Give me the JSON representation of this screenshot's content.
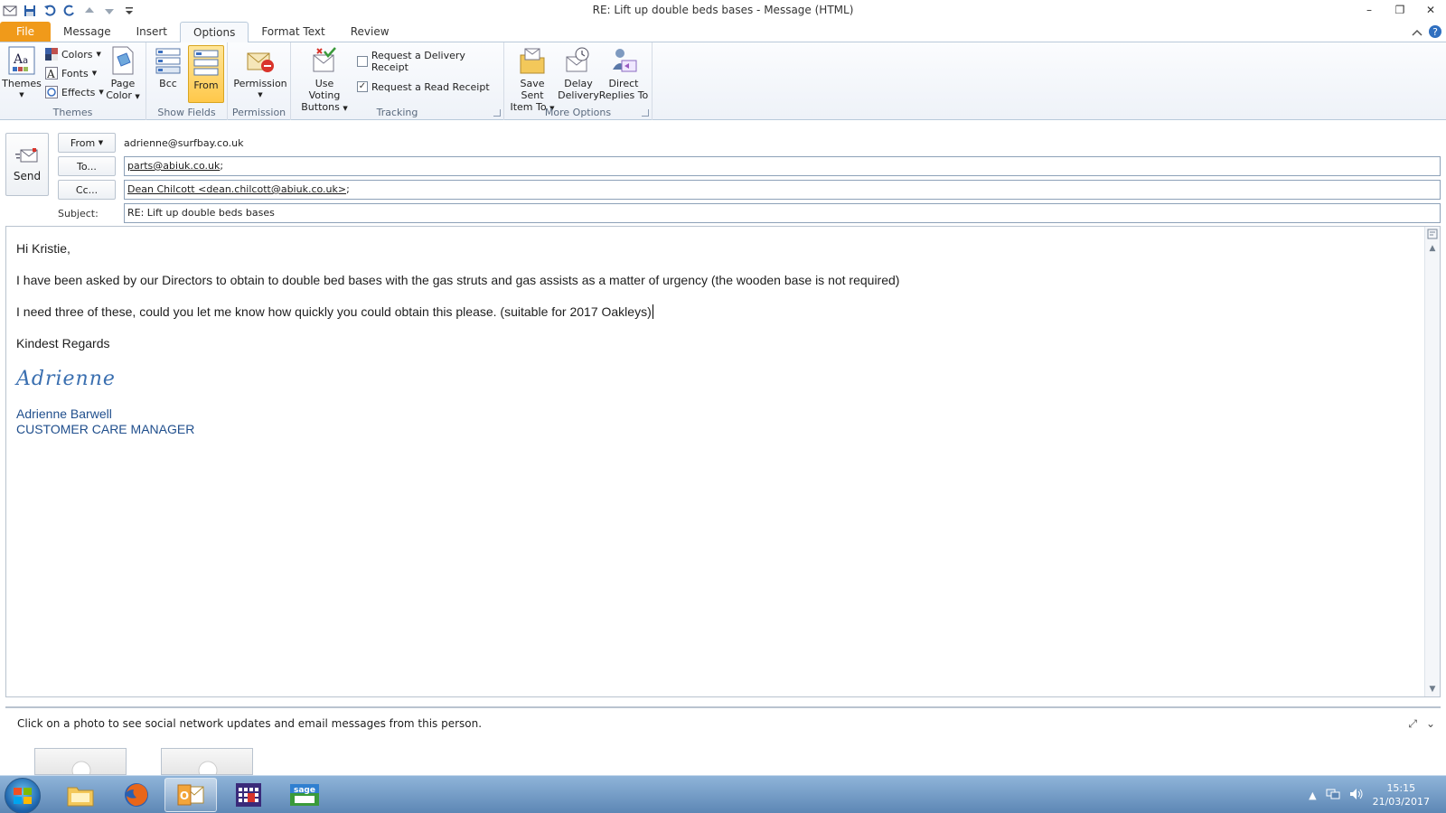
{
  "window": {
    "title": "RE: Lift up double beds bases  -  Message (HTML)",
    "minimize": "–",
    "restore": "❐",
    "close": "✕"
  },
  "tabs": [
    "File",
    "Message",
    "Insert",
    "Options",
    "Format Text",
    "Review"
  ],
  "active_tab": "Options",
  "ribbon": {
    "themes": {
      "themes_label": "Themes",
      "colors_label": "Colors",
      "fonts_label": "Fonts",
      "effects_label": "Effects",
      "page_color_label_1": "Page",
      "page_color_label_2": "Color",
      "group_label": "Themes"
    },
    "show_fields": {
      "bcc_label": "Bcc",
      "from_label": "From",
      "group_label": "Show Fields"
    },
    "permission": {
      "permission_label": "Permission",
      "group_label": "Permission"
    },
    "tracking": {
      "voting_label_1": "Use Voting",
      "voting_label_2": "Buttons",
      "delivery_receipt_label": "Request a Delivery Receipt",
      "delivery_receipt_checked": false,
      "read_receipt_label": "Request a Read Receipt",
      "read_receipt_checked": true,
      "group_label": "Tracking"
    },
    "more_options": {
      "save_sent_label_1": "Save Sent",
      "save_sent_label_2": "Item To",
      "delay_label_1": "Delay",
      "delay_label_2": "Delivery",
      "direct_label_1": "Direct",
      "direct_label_2": "Replies To",
      "group_label": "More Options"
    }
  },
  "compose": {
    "send_label": "Send",
    "from_button": "From",
    "from_value": "adrienne@surfbay.co.uk",
    "to_button": "To...",
    "to_value": "parts@abiuk.co.uk",
    "to_sep": ";",
    "cc_button": "Cc...",
    "cc_value": "Dean Chilcott <dean.chilcott@abiuk.co.uk>",
    "cc_sep": ";",
    "subject_label": "Subject:",
    "subject_value": "RE: Lift up double beds bases"
  },
  "body": {
    "greeting": "Hi Kristie,",
    "para1": "I have been asked by our Directors to obtain to double bed bases with the gas struts and gas assists as a matter of urgency (the wooden base is not required)",
    "para2": "I need three of these, could you let me know how quickly you could obtain this please. (suitable for 2017 Oakleys)",
    "closing": "Kindest Regards",
    "signature_script": "Adrienne",
    "signature_name": "Adrienne Barwell",
    "signature_title": "CUSTOMER CARE MANAGER"
  },
  "people_pane": {
    "message": "Click on a photo to see social network updates and email messages from this person."
  },
  "taskbar": {
    "time": "15:15",
    "date": "21/03/2017"
  },
  "colors": {
    "file_tab": "#f09a1a",
    "selected_button": "#ffc84a",
    "signature_blue": "#1f4e8c",
    "taskbar": "#6f97c4"
  }
}
